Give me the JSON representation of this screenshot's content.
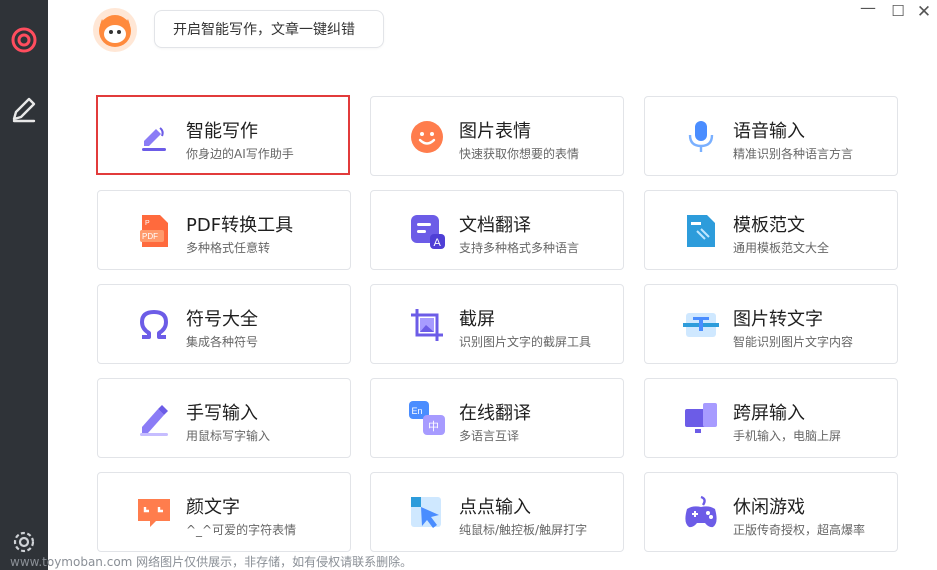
{
  "assistant": {
    "bubble_text": "开启智能写作，文章一键纠错"
  },
  "window_controls": {
    "minimize": "—",
    "maximize": "☐",
    "close": "✕"
  },
  "colors": {
    "sidebar": "#2f3338",
    "accent_red": "#e23b3b",
    "accent_purple": "#6c5ce7",
    "accent_orange": "#ff7d4d",
    "accent_blue": "#4a8dff"
  },
  "tools": [
    {
      "title": "智能写作",
      "subtitle": "你身边的AI写作助手",
      "icon": "pen-icon"
    },
    {
      "title": "图片表情",
      "subtitle": "快速获取你想要的表情",
      "icon": "smiley-icon"
    },
    {
      "title": "语音输入",
      "subtitle": "精准识别各种语言方言",
      "icon": "microphone-icon"
    },
    {
      "title": "PDF转换工具",
      "subtitle": "多种格式任意转",
      "icon": "pdf-icon"
    },
    {
      "title": "文档翻译",
      "subtitle": "支持多种格式多种语言",
      "icon": "doc-translate-icon"
    },
    {
      "title": "模板范文",
      "subtitle": "通用模板范文大全",
      "icon": "template-icon"
    },
    {
      "title": "符号大全",
      "subtitle": "集成各种符号",
      "icon": "omega-icon"
    },
    {
      "title": "截屏",
      "subtitle": "识别图片文字的截屏工具",
      "icon": "screenshot-icon"
    },
    {
      "title": "图片转文字",
      "subtitle": "智能识别图片文字内容",
      "icon": "ocr-icon"
    },
    {
      "title": "手写输入",
      "subtitle": "用鼠标写字输入",
      "icon": "handwrite-icon"
    },
    {
      "title": "在线翻译",
      "subtitle": "多语言互译",
      "icon": "translate-icon"
    },
    {
      "title": "跨屏输入",
      "subtitle": "手机输入，电脑上屏",
      "icon": "cross-screen-icon"
    },
    {
      "title": "颜文字",
      "subtitle": "^_^可爱的字符表情",
      "icon": "emoticon-icon"
    },
    {
      "title": "点点输入",
      "subtitle": "纯鼠标/触控板/触屏打字",
      "icon": "pointer-input-icon"
    },
    {
      "title": "休闲游戏",
      "subtitle": "正版传奇授权，超高爆率",
      "icon": "gamepad-icon"
    }
  ],
  "watermark": "www.toymoban.com 网络图片仅供展示，非存储，如有侵权请联系删除。"
}
